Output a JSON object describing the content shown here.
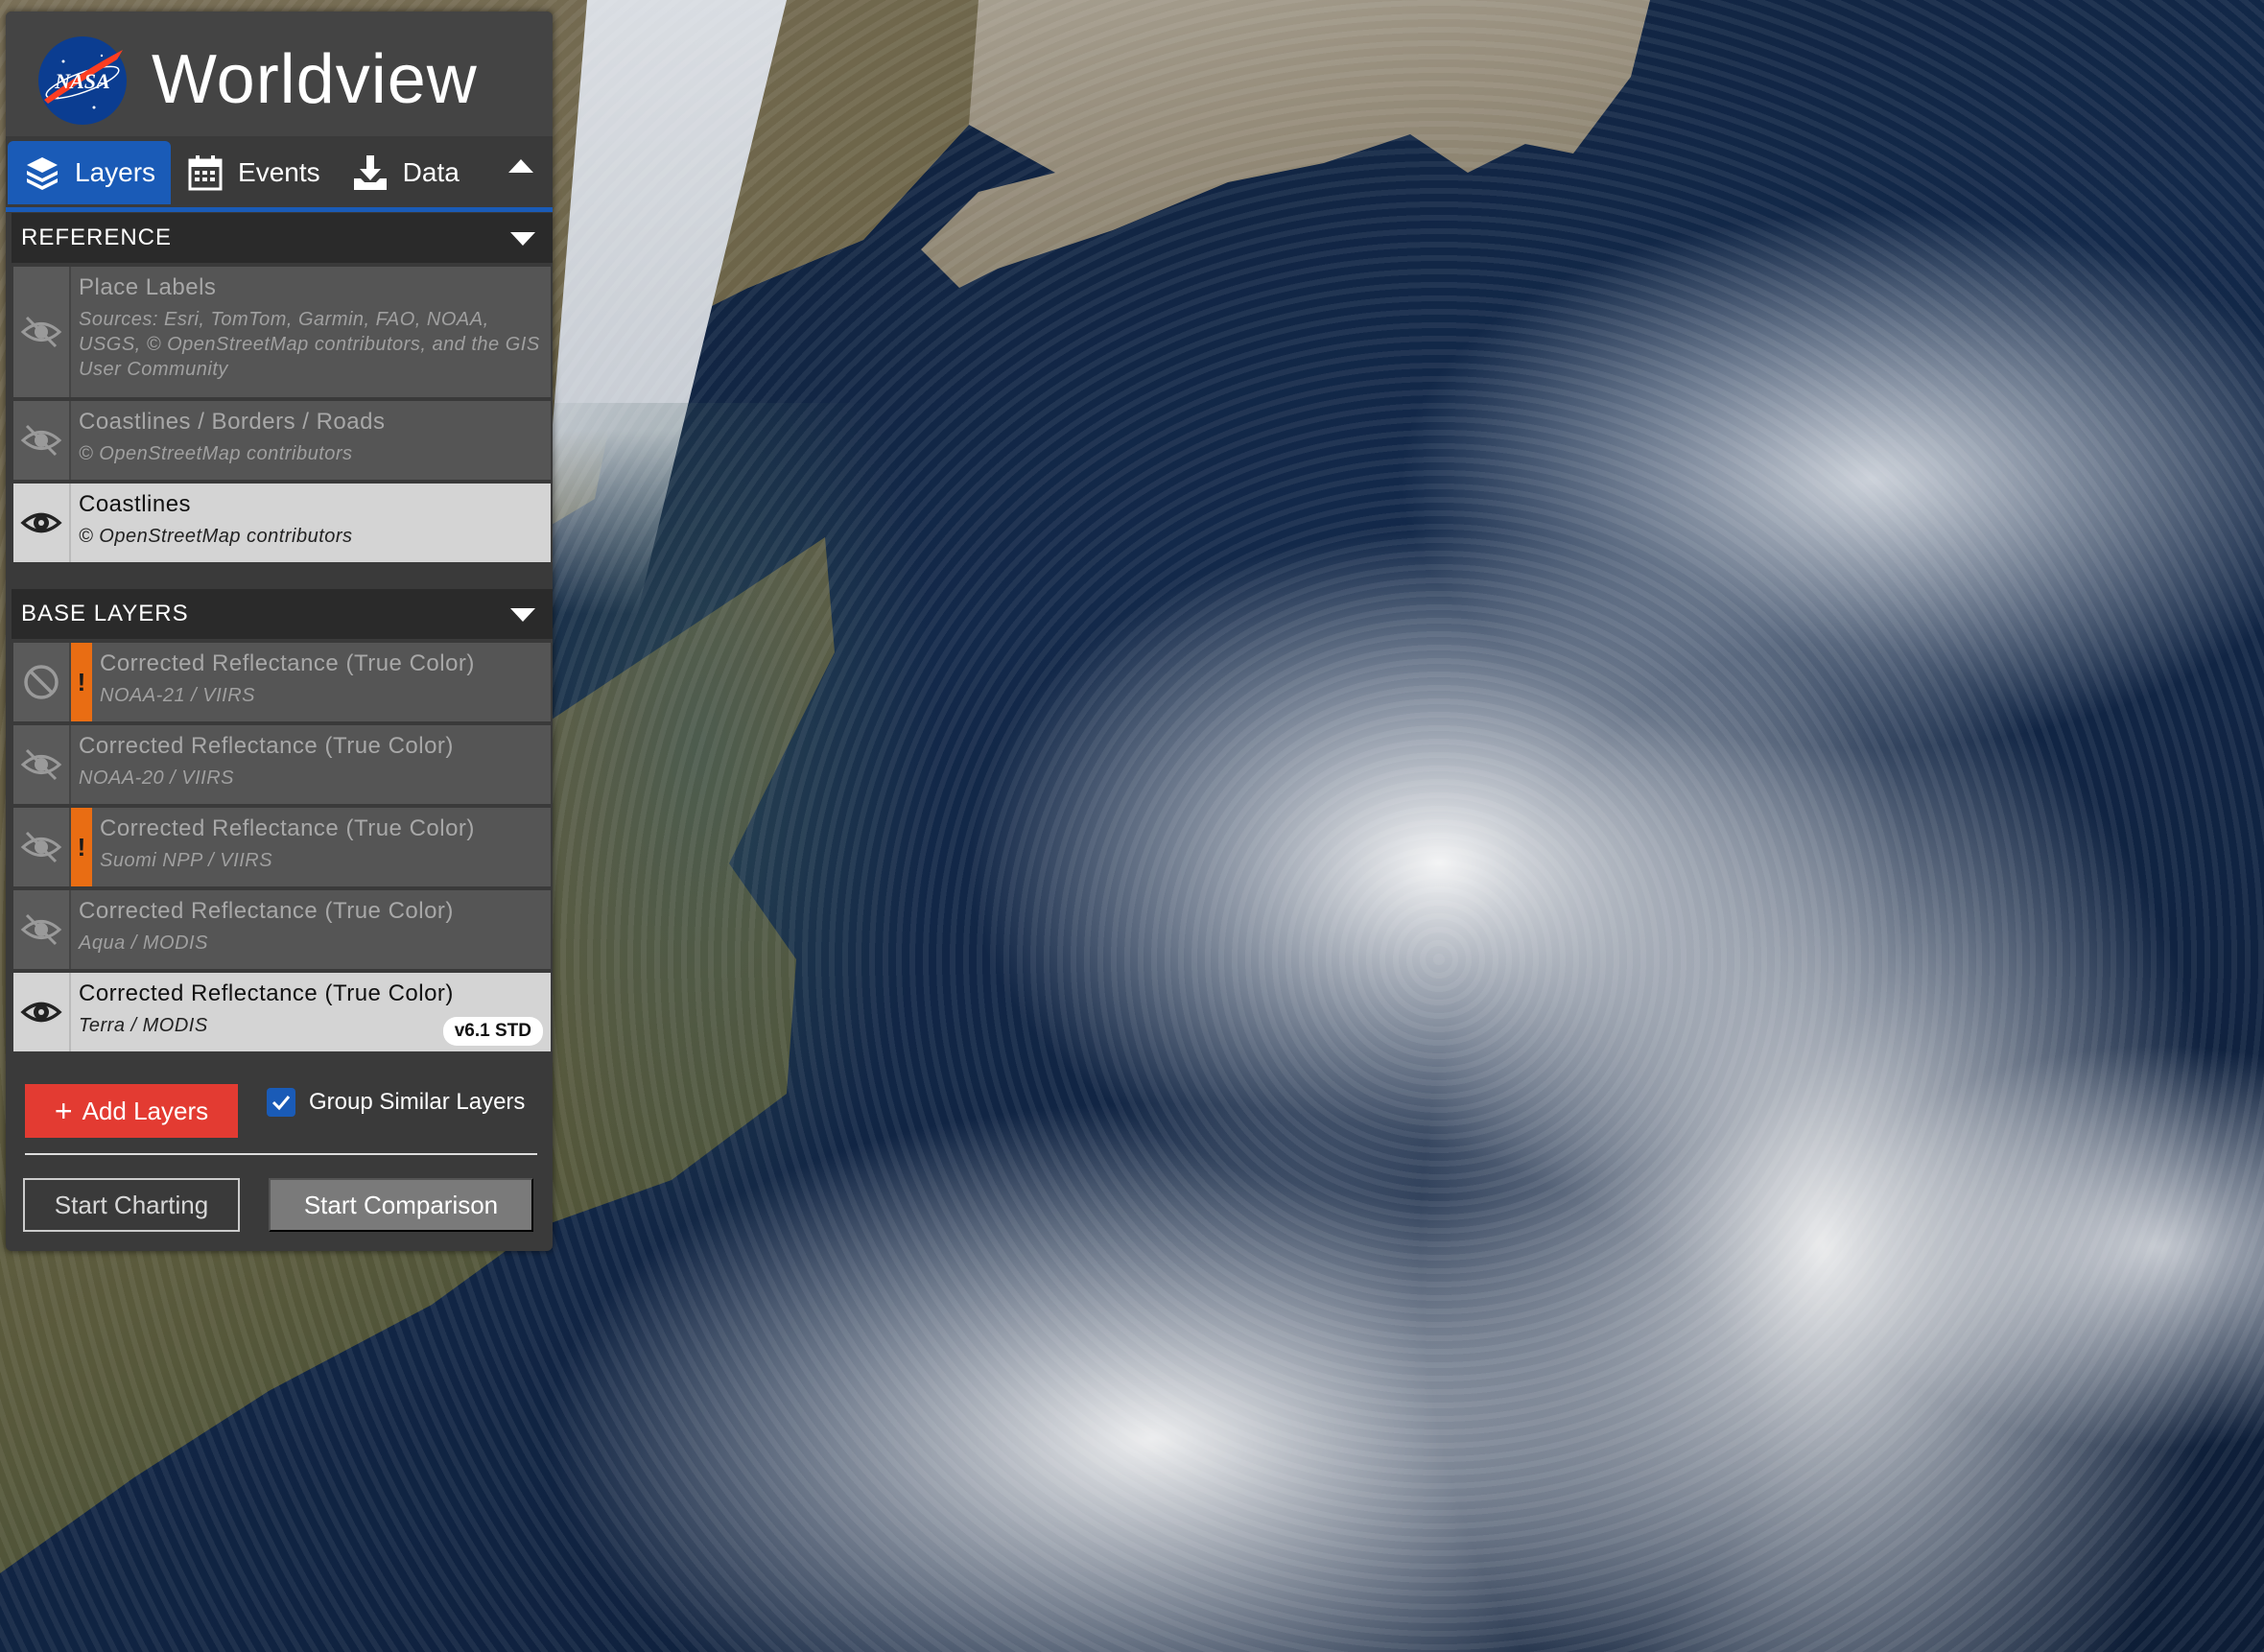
{
  "app": {
    "title": "Worldview",
    "logo_text": "NASA"
  },
  "tabs": [
    {
      "label": "Layers",
      "icon": "layers-icon",
      "active": true
    },
    {
      "label": "Events",
      "icon": "calendar-icon",
      "active": false
    },
    {
      "label": "Data",
      "icon": "download-icon",
      "active": false
    }
  ],
  "sections": {
    "reference": {
      "title": "REFERENCE",
      "layers": [
        {
          "name": "Place Labels",
          "source": "Sources: Esri, TomTom, Garmin, FAO, NOAA, USGS, © OpenStreetMap contributors, and the GIS User Community",
          "visible": false,
          "warning": false
        },
        {
          "name": "Coastlines / Borders / Roads",
          "source": "© OpenStreetMap contributors",
          "visible": false,
          "warning": false
        },
        {
          "name": "Coastlines",
          "source": "© OpenStreetMap contributors",
          "visible": true,
          "warning": false
        }
      ]
    },
    "base": {
      "title": "BASE LAYERS",
      "layers": [
        {
          "name": "Corrected Reflectance (True Color)",
          "source": "NOAA-21 / VIIRS",
          "visible": false,
          "warning": true,
          "disabled": true
        },
        {
          "name": "Corrected Reflectance (True Color)",
          "source": "NOAA-20 / VIIRS",
          "visible": false,
          "warning": false
        },
        {
          "name": "Corrected Reflectance (True Color)",
          "source": "Suomi NPP / VIIRS",
          "visible": false,
          "warning": true
        },
        {
          "name": "Corrected Reflectance (True Color)",
          "source": "Aqua / MODIS",
          "visible": false,
          "warning": false
        },
        {
          "name": "Corrected Reflectance (True Color)",
          "source": "Terra / MODIS",
          "visible": true,
          "warning": false,
          "badge": "v6.1 STD"
        }
      ]
    }
  },
  "warning_mark": "!",
  "actions": {
    "add_layers": "Add Layers",
    "add_icon": "+",
    "group_similar": "Group Similar Layers",
    "group_checked": true,
    "start_charting": "Start Charting",
    "start_comparison": "Start Comparison"
  },
  "colors": {
    "accent": "#1a5bb7",
    "add_button": "#e33b32",
    "warning": "#e96d13"
  }
}
